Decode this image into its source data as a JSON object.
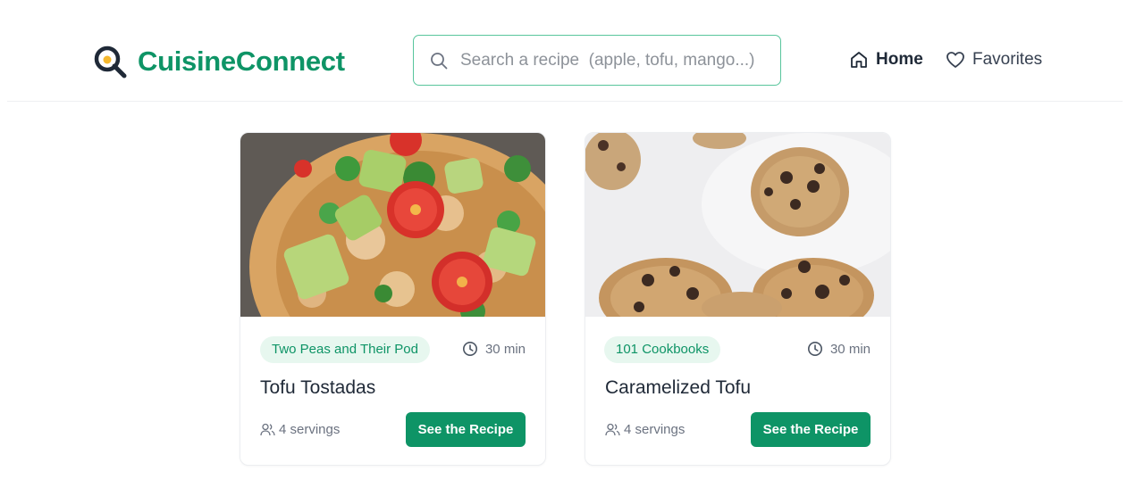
{
  "brand": {
    "name": "CuisineConnect",
    "color": "#0e9466",
    "icon": "frying-pan-magnifier-icon"
  },
  "search": {
    "placeholder": "Search a recipe  (apple, tofu, mango...)",
    "value": "",
    "icon": "search-icon"
  },
  "nav": {
    "home": {
      "label": "Home",
      "icon": "home-icon",
      "active": true
    },
    "favorites": {
      "label": "Favorites",
      "icon": "heart-icon",
      "active": false
    }
  },
  "recipes": [
    {
      "image": "tofu-tostadas-photo",
      "source": "Two Peas and Their Pod",
      "time": "30 min",
      "title": "Tofu Tostadas",
      "servings": "4 servings",
      "button_label": "See the Recipe"
    },
    {
      "image": "caramelized-tofu-photo",
      "source": "101 Cookbooks",
      "time": "30 min",
      "title": "Caramelized Tofu",
      "servings": "4 servings",
      "button_label": "See the Recipe"
    }
  ],
  "colors": {
    "accent": "#0e9466",
    "badge_bg": "#e7f7ef",
    "search_border": "#58c59c"
  }
}
